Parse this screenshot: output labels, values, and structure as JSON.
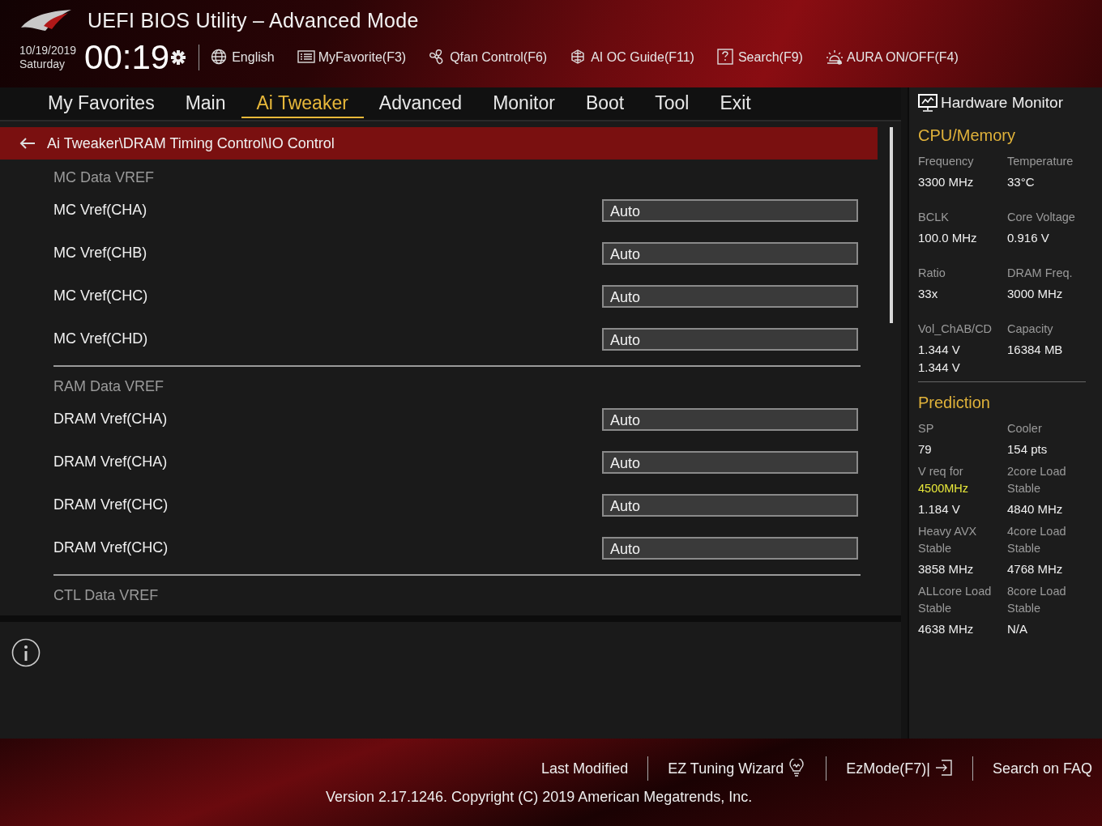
{
  "window": {
    "title": "UEFI BIOS Utility – Advanced Mode"
  },
  "clock": {
    "date": "10/19/2019",
    "day": "Saturday",
    "time": "00:19"
  },
  "toolbar": [
    {
      "label": "English",
      "kind": "globe"
    },
    {
      "label": "MyFavorite(F3)",
      "kind": "list"
    },
    {
      "label": "Qfan Control(F6)",
      "kind": "fan"
    },
    {
      "label": "AI OC Guide(F11)",
      "kind": "chip"
    },
    {
      "label": "Search(F9)",
      "kind": "help"
    },
    {
      "label": "AURA ON/OFF(F4)",
      "kind": "light"
    }
  ],
  "tabs": [
    {
      "label": "My Favorites",
      "selected": false
    },
    {
      "label": "Main",
      "selected": false
    },
    {
      "label": "Ai Tweaker",
      "selected": true
    },
    {
      "label": "Advanced",
      "selected": false
    },
    {
      "label": "Monitor",
      "selected": false
    },
    {
      "label": "Boot",
      "selected": false
    },
    {
      "label": "Tool",
      "selected": false
    },
    {
      "label": "Exit",
      "selected": false
    }
  ],
  "breadcrumb": "Ai Tweaker\\DRAM Timing Control\\IO Control",
  "sections": [
    {
      "title": "MC Data VREF",
      "settings": [
        {
          "label": "MC Vref(CHA)",
          "value": "Auto"
        },
        {
          "label": "MC Vref(CHB)",
          "value": "Auto"
        },
        {
          "label": "MC Vref(CHC)",
          "value": "Auto"
        },
        {
          "label": "MC Vref(CHD)",
          "value": "Auto"
        }
      ]
    },
    {
      "title": "RAM Data VREF",
      "settings": [
        {
          "label": "DRAM Vref(CHA)",
          "value": "Auto"
        },
        {
          "label": "DRAM Vref(CHA)",
          "value": "Auto"
        },
        {
          "label": "DRAM Vref(CHC)",
          "value": "Auto"
        },
        {
          "label": "DRAM Vref(CHC)",
          "value": "Auto"
        }
      ]
    },
    {
      "title": "CTL Data VREF"
    }
  ],
  "hardware_monitor": {
    "title": "Hardware Monitor",
    "groups": [
      {
        "title": "CPU/Memory",
        "items": [
          {
            "label": "Frequency",
            "values": [
              "3300 MHz"
            ]
          },
          {
            "label": "Temperature",
            "values": [
              "33°C"
            ]
          },
          {
            "label": "BCLK",
            "values": [
              "100.0 MHz"
            ]
          },
          {
            "label": "Core Voltage",
            "values": [
              "0.916 V"
            ]
          },
          {
            "label": "Ratio",
            "values": [
              "33x"
            ]
          },
          {
            "label": "DRAM Freq.",
            "values": [
              "3000 MHz"
            ]
          },
          {
            "label": "Vol_ChAB/CD",
            "values": [
              "1.344 V",
              "1.344 V"
            ]
          },
          {
            "label": "Capacity",
            "values": [
              "16384 MB"
            ]
          }
        ]
      },
      {
        "title": "Prediction",
        "items": [
          {
            "label": "SP",
            "values": [
              "79"
            ]
          },
          {
            "label": "Cooler",
            "values": [
              "154 pts"
            ]
          },
          {
            "label": "V req for",
            "highlight": "4500MHz",
            "values": [
              "1.184 V"
            ]
          },
          {
            "label": "2core Load Stable",
            "values": [
              "4840 MHz"
            ]
          },
          {
            "label": "Heavy AVX Stable",
            "values": [
              "3858 MHz"
            ]
          },
          {
            "label": "4core Load Stable",
            "values": [
              "4768 MHz"
            ]
          },
          {
            "label": "ALLcore Load Stable",
            "values": [
              "4638 MHz"
            ]
          },
          {
            "label": "8core Load Stable",
            "values": [
              "N/A"
            ]
          }
        ]
      }
    ]
  },
  "footer": {
    "links": [
      {
        "label": "Last Modified",
        "kind": "text"
      },
      {
        "label": "EZ Tuning Wizard",
        "kind": "bulb"
      },
      {
        "label": "EzMode(F7)|",
        "kind": "exit"
      },
      {
        "label": "Search on FAQ",
        "kind": "text"
      }
    ],
    "version": "Version 2.17.1246. Copyright (C) 2019 American Megatrends, Inc."
  }
}
